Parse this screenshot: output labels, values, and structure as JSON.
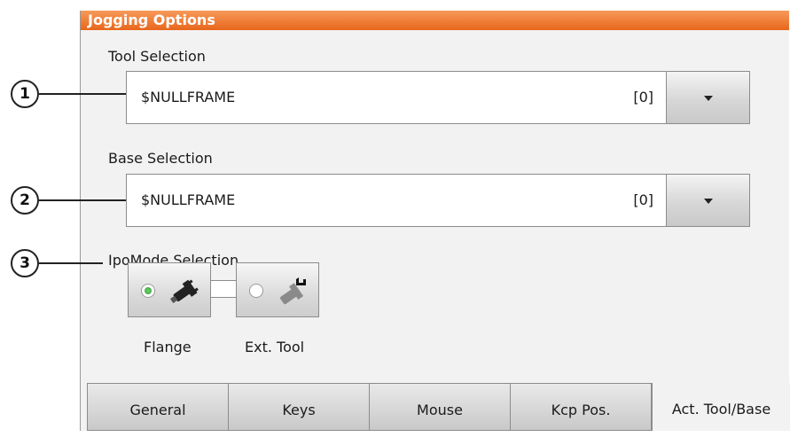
{
  "window": {
    "title": "Jogging Options"
  },
  "tool": {
    "label": "Tool Selection",
    "value": "$NULLFRAME",
    "index": "[0]"
  },
  "base": {
    "label": "Base Selection",
    "value": "$NULLFRAME",
    "index": "[0]"
  },
  "ipomode": {
    "label": "IpoMode Selection",
    "options": [
      {
        "label": "Flange",
        "selected": true,
        "icon": "flange-robot-icon"
      },
      {
        "label": "Ext. Tool",
        "selected": false,
        "icon": "external-tool-icon"
      }
    ]
  },
  "callouts": [
    "1",
    "2",
    "3"
  ],
  "tabs": [
    "General",
    "Keys",
    "Mouse",
    "Kcp Pos.",
    "Act. Tool/Base"
  ],
  "active_tab": "Act. Tool/Base",
  "colors": {
    "title_bar": "#ee7a33",
    "selected_radio": "#3aa83a"
  }
}
